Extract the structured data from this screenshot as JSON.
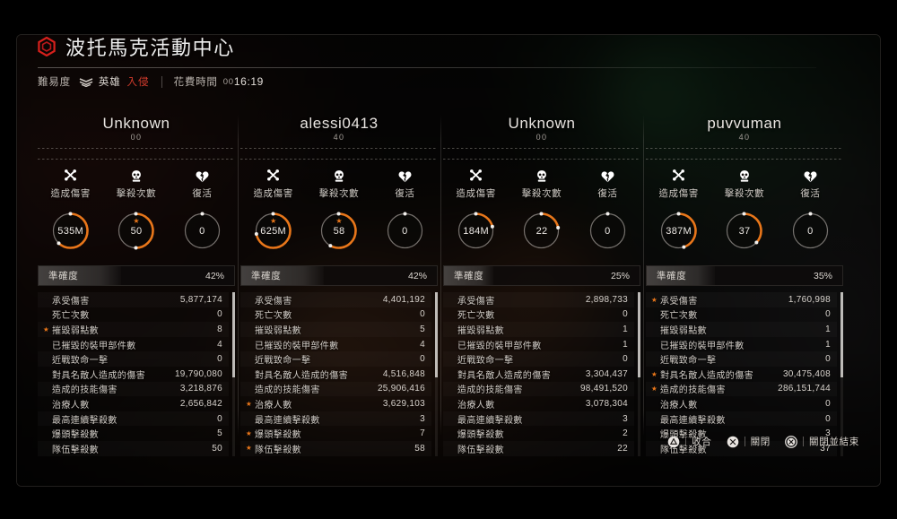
{
  "header": {
    "mission_title": "波托馬克活動中心",
    "icon": "hexagon-icon",
    "difficulty_label": "難易度",
    "difficulty_icon": "chevrons-icon",
    "difficulty_value": "英雄",
    "invaded_label": "入侵",
    "time_label": "花費時間",
    "time_hours": "00",
    "time_value": "16:19",
    "accent_red": "#d23b2c",
    "accent_orange": "#e8761a"
  },
  "stat_headers": {
    "damage": {
      "label": "造成傷害",
      "icon": "crossed-bones-icon"
    },
    "kills": {
      "label": "擊殺次數",
      "icon": "skull-icon"
    },
    "revives": {
      "label": "復活",
      "icon": "broken-heart-icon"
    },
    "accuracy_label": "準確度"
  },
  "stat_rows": [
    "承受傷害",
    "死亡次數",
    "摧毀弱點數",
    "已摧毀的裝甲部件數",
    "近戰致命一擊",
    "對具名敵人造成的傷害",
    "造成的技能傷害",
    "治療人數",
    "最高連續擊殺數",
    "爆頭擊殺數",
    "隊伍擊殺數"
  ],
  "players": [
    {
      "name": "Unknown",
      "level": "00",
      "damage": "535M",
      "damage_pct": 62,
      "damage_best": false,
      "kills": "50",
      "kills_pct": 50,
      "kills_best": true,
      "revives": "0",
      "revives_pct": 0,
      "revives_best": false,
      "accuracy": "42%",
      "accuracy_pct": 42,
      "values": [
        "5,877,174",
        "0",
        "8",
        "4",
        "0",
        "19,790,080",
        "3,218,876",
        "2,656,842",
        "0",
        "5",
        "50"
      ],
      "best": [
        false,
        false,
        true,
        false,
        false,
        false,
        false,
        false,
        false,
        false,
        false
      ]
    },
    {
      "name": "alessi0413",
      "level": "40",
      "damage": "625M",
      "damage_pct": 72,
      "damage_best": true,
      "kills": "58",
      "kills_pct": 58,
      "kills_best": true,
      "revives": "0",
      "revives_pct": 0,
      "revives_best": false,
      "accuracy": "42%",
      "accuracy_pct": 42,
      "values": [
        "4,401,192",
        "0",
        "5",
        "4",
        "0",
        "4,516,848",
        "25,906,416",
        "3,629,103",
        "3",
        "7",
        "58"
      ],
      "best": [
        false,
        false,
        false,
        false,
        false,
        false,
        false,
        true,
        false,
        true,
        true
      ]
    },
    {
      "name": "Unknown",
      "level": "00",
      "damage": "184M",
      "damage_pct": 21,
      "damage_best": false,
      "kills": "22",
      "kills_pct": 22,
      "kills_best": false,
      "revives": "0",
      "revives_pct": 0,
      "revives_best": false,
      "accuracy": "25%",
      "accuracy_pct": 25,
      "values": [
        "2,898,733",
        "0",
        "1",
        "1",
        "0",
        "3,304,437",
        "98,491,520",
        "3,078,304",
        "3",
        "2",
        "22"
      ],
      "best": [
        false,
        false,
        false,
        false,
        false,
        false,
        false,
        false,
        false,
        false,
        false
      ]
    },
    {
      "name": "puvvuman",
      "level": "40",
      "damage": "387M",
      "damage_pct": 45,
      "damage_best": false,
      "kills": "37",
      "kills_pct": 37,
      "kills_best": false,
      "revives": "0",
      "revives_pct": 0,
      "revives_best": false,
      "accuracy": "35%",
      "accuracy_pct": 35,
      "values": [
        "1,760,998",
        "0",
        "1",
        "1",
        "0",
        "30,475,408",
        "286,151,744",
        "0",
        "0",
        "3",
        "37"
      ],
      "best": [
        true,
        false,
        false,
        false,
        false,
        true,
        true,
        false,
        false,
        false,
        false
      ]
    }
  ],
  "footer": {
    "buttons": [
      {
        "icon": "triangle-button-icon",
        "label": "收合"
      },
      {
        "icon": "circle-cross-icon",
        "label": "關閉"
      },
      {
        "icon": "options-button-icon",
        "label": "關閉並結束"
      }
    ]
  }
}
